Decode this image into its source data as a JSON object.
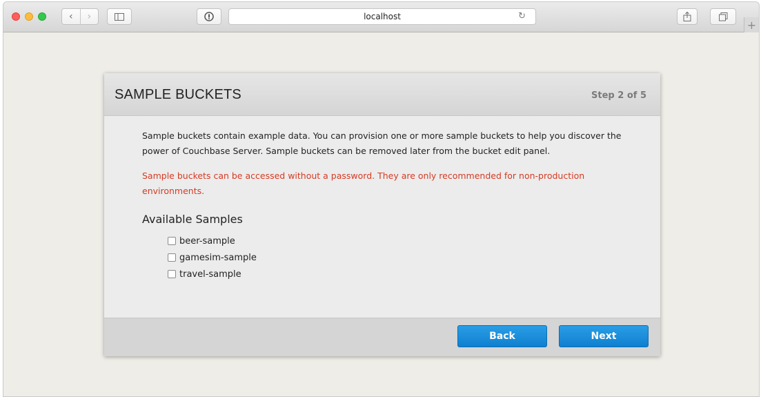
{
  "browser": {
    "address": "localhost",
    "new_tab_label": "+"
  },
  "dialog": {
    "title": "SAMPLE BUCKETS",
    "step": "Step 2 of 5",
    "description": "Sample buckets contain example data. You can provision one or more sample buckets to help you discover the power of Couchbase Server. Sample buckets can be removed later from the bucket edit panel.",
    "warning": "Sample buckets can be accessed without a password. They are only recommended for non-production environments.",
    "samples_heading": "Available Samples",
    "samples": [
      {
        "label": "beer-sample",
        "checked": false
      },
      {
        "label": "gamesim-sample",
        "checked": false
      },
      {
        "label": "travel-sample",
        "checked": false
      }
    ],
    "back_label": "Back",
    "next_label": "Next"
  }
}
